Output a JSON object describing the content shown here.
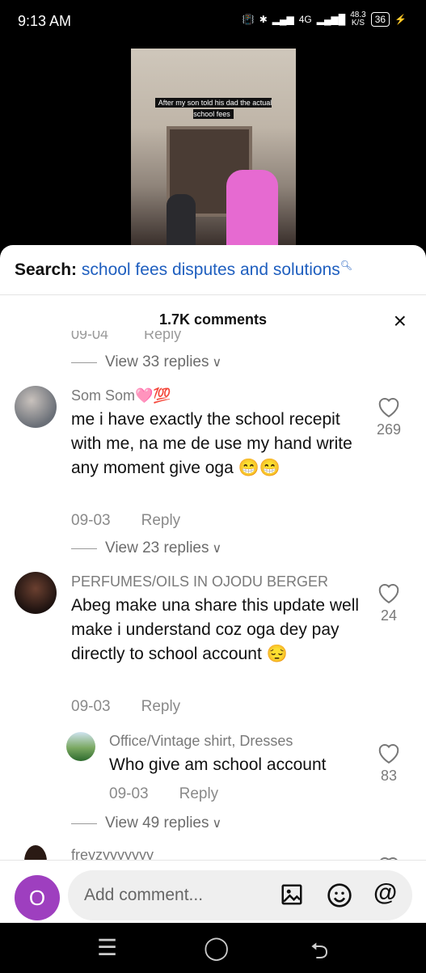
{
  "status_bar": {
    "time": "9:13 AM",
    "network": "4G",
    "speed": "48.3",
    "speed_unit": "K/S",
    "battery": "36"
  },
  "video": {
    "caption": "After my son told his dad the actual school fees"
  },
  "search": {
    "label": "Search:",
    "query": "school fees disputes and solutions"
  },
  "comments_header": {
    "count": "1.7K comments",
    "close_icon": "×"
  },
  "faded_row": {
    "date": "09-04",
    "reply": "Reply"
  },
  "view_replies": [
    {
      "label": "View 33 replies"
    },
    {
      "label": "View 23 replies"
    },
    {
      "label": "View 49 replies"
    }
  ],
  "comments": [
    {
      "username": "Som Som🩷💯",
      "text": "me i have exactly the school recepit with me, na me de use my hand write any moment give oga 😁😁",
      "date": "09-03",
      "reply": "Reply",
      "likes": "269"
    },
    {
      "username": "PERFUMES/OILS IN OJODU BERGER",
      "text": "Abeg make una share this update well make i understand coz oga dey pay directly to school account 😔",
      "date": "09-03",
      "reply": "Reply",
      "likes": "24"
    },
    {
      "username": "Office/Vintage shirt, Dresses",
      "text": "Who give am school account",
      "date": "09-03",
      "reply": "Reply",
      "likes": "83"
    },
    {
      "username": "freyzyyyyyyy"
    }
  ],
  "comment_input": {
    "placeholder": "Add comment...",
    "user_initial": "O"
  },
  "colors": {
    "link": "#1f5fbf",
    "user_avatar": "#9e3fbf"
  }
}
